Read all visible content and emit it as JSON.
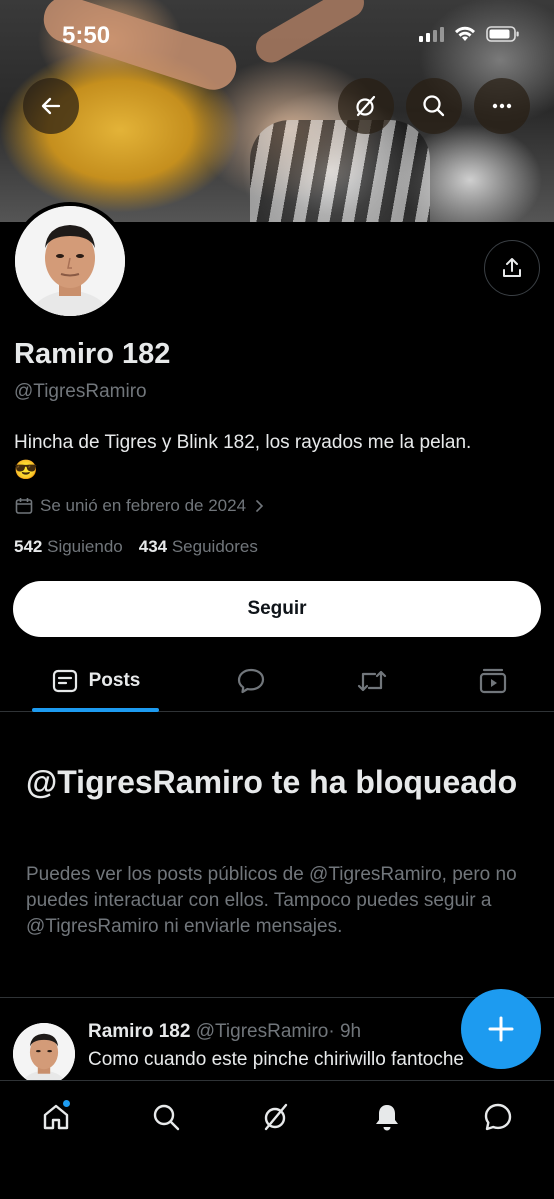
{
  "status_bar": {
    "time": "5:50"
  },
  "profile": {
    "name": "Ramiro 182",
    "handle": "@TigresRamiro",
    "bio": "Hincha de Tigres y Blink 182, los rayados me la pelan.",
    "bio_emoji": "😎",
    "joined": "Se unió en febrero de 2024",
    "following_count": "542",
    "following_label": "Siguiendo",
    "followers_count": "434",
    "followers_label": "Seguidores",
    "follow_button": "Seguir"
  },
  "tabs": [
    {
      "label": "Posts",
      "icon": "posts-icon",
      "active": true
    },
    {
      "label": "",
      "icon": "replies-icon",
      "active": false
    },
    {
      "label": "",
      "icon": "repost-icon",
      "active": false
    },
    {
      "label": "",
      "icon": "media-icon",
      "active": false
    }
  ],
  "blocked": {
    "title": "@TigresRamiro te ha bloqueado",
    "description": "Puedes ver los posts públicos de @TigresRamiro, pero no puedes interactuar con ellos. Tampoco puedes seguir a @TigresRamiro ni enviarle mensajes."
  },
  "post": {
    "name": "Ramiro 182",
    "handle": "@TigresRamiro",
    "time": "· 9h",
    "text": "Como cuando este pinche chiriwillo fantoche"
  },
  "bottom_nav": [
    "home-icon",
    "search-icon",
    "grok-icon",
    "notifications-icon",
    "messages-icon"
  ],
  "colors": {
    "accent": "#1d9bf0",
    "background": "#000000",
    "secondary_text": "#71767b"
  }
}
